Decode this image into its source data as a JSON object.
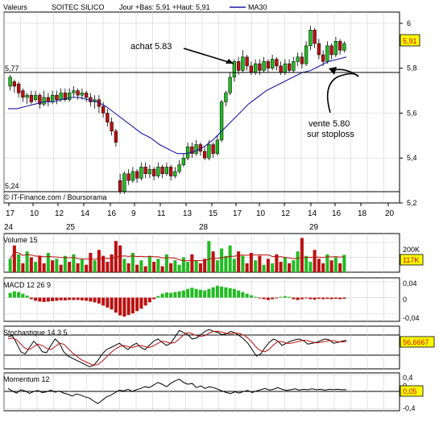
{
  "header": {
    "valeurs": "Valeurs",
    "symbol": "SOITEC SILICO",
    "ohlc": "Jour +Bas: 5,91 +Haut: 5,91",
    "ma_label": "MA30"
  },
  "main": {
    "credit": "IT-Finance.com / Boursorama",
    "last_price": "5,91",
    "ref_high": "5,77",
    "ref_low": "5,24",
    "y_ticks": [
      "6",
      "5,8",
      "5,6",
      "5,4",
      "5,2"
    ],
    "x_ticks": [
      "17",
      "10",
      "12",
      "14",
      "16",
      "9",
      "11",
      "13",
      "15",
      "17",
      "10",
      "12",
      "14",
      "16",
      "18",
      "20"
    ],
    "x_days": [
      "24",
      "25",
      "28",
      "29"
    ],
    "annot_buy": "achat 5.83",
    "annot_sell1": "vente 5.80",
    "annot_sell2": "sur stoploss"
  },
  "volume": {
    "title": "Volume 15",
    "tick": "200K",
    "value": "117K"
  },
  "macd": {
    "title": "MACD 12 26 9",
    "ticks": [
      "0,04",
      "0",
      "-0,04"
    ]
  },
  "stoch": {
    "title": "Stochastique 14 3 5",
    "value": "56,6667"
  },
  "momentum": {
    "title": "Momentum 12",
    "ticks": [
      "0,4",
      "0",
      "-0,4"
    ],
    "value": "0,05"
  },
  "colors": {
    "up": "#22bb22",
    "down": "#bb1111",
    "ma": "#1a1aa0",
    "badge": "#ffff00",
    "badge_text": "#cc0000"
  },
  "chart_data": [
    {
      "type": "candlestick",
      "title": "SOITEC SILICO",
      "overlay": "MA30",
      "ylim": [
        5.2,
        6.05
      ],
      "x_day_labels": [
        "24",
        "25",
        "28",
        "29"
      ],
      "reference_lines": [
        5.77,
        5.24
      ],
      "candles": [
        [
          5.72,
          5.76,
          5.7,
          5.77
        ],
        [
          5.74,
          5.72,
          5.69,
          5.75
        ],
        [
          5.73,
          5.69,
          5.67,
          5.74
        ],
        [
          5.7,
          5.67,
          5.65,
          5.71
        ],
        [
          5.67,
          5.68,
          5.64,
          5.69
        ],
        [
          5.68,
          5.65,
          5.64,
          5.7
        ],
        [
          5.66,
          5.68,
          5.65,
          5.7
        ],
        [
          5.68,
          5.64,
          5.62,
          5.69
        ],
        [
          5.64,
          5.67,
          5.63,
          5.7
        ],
        [
          5.67,
          5.65,
          5.63,
          5.69
        ],
        [
          5.65,
          5.68,
          5.64,
          5.7
        ],
        [
          5.68,
          5.66,
          5.64,
          5.7
        ],
        [
          5.66,
          5.69,
          5.65,
          5.71
        ],
        [
          5.69,
          5.66,
          5.65,
          5.71
        ],
        [
          5.66,
          5.69,
          5.65,
          5.71
        ],
        [
          5.69,
          5.7,
          5.67,
          5.72
        ],
        [
          5.7,
          5.68,
          5.66,
          5.71
        ],
        [
          5.68,
          5.69,
          5.66,
          5.71
        ],
        [
          5.69,
          5.67,
          5.65,
          5.7
        ],
        [
          5.67,
          5.65,
          5.63,
          5.69
        ],
        [
          5.65,
          5.66,
          5.62,
          5.68
        ],
        [
          5.66,
          5.63,
          5.6,
          5.68
        ],
        [
          5.63,
          5.6,
          5.58,
          5.65
        ],
        [
          5.6,
          5.56,
          5.54,
          5.62
        ],
        [
          5.56,
          5.52,
          5.5,
          5.58
        ],
        [
          5.52,
          5.47,
          5.45,
          5.53
        ],
        [
          5.3,
          5.25,
          5.24,
          5.33
        ],
        [
          5.25,
          5.33,
          5.24,
          5.34
        ],
        [
          5.33,
          5.3,
          5.28,
          5.35
        ],
        [
          5.3,
          5.34,
          5.29,
          5.36
        ],
        [
          5.34,
          5.31,
          5.29,
          5.35
        ],
        [
          5.31,
          5.36,
          5.3,
          5.38
        ],
        [
          5.36,
          5.33,
          5.31,
          5.38
        ],
        [
          5.33,
          5.35,
          5.31,
          5.37
        ],
        [
          5.35,
          5.32,
          5.3,
          5.36
        ],
        [
          5.32,
          5.36,
          5.31,
          5.38
        ],
        [
          5.36,
          5.33,
          5.31,
          5.37
        ],
        [
          5.33,
          5.36,
          5.32,
          5.38
        ],
        [
          5.36,
          5.32,
          5.3,
          5.37
        ],
        [
          5.32,
          5.34,
          5.31,
          5.36
        ],
        [
          5.34,
          5.37,
          5.33,
          5.39
        ],
        [
          5.37,
          5.4,
          5.36,
          5.42
        ],
        [
          5.4,
          5.45,
          5.39,
          5.47
        ],
        [
          5.45,
          5.42,
          5.4,
          5.47
        ],
        [
          5.42,
          5.46,
          5.41,
          5.48
        ],
        [
          5.46,
          5.43,
          5.41,
          5.47
        ],
        [
          5.43,
          5.4,
          5.39,
          5.45
        ],
        [
          5.4,
          5.46,
          5.39,
          5.48
        ],
        [
          5.46,
          5.42,
          5.4,
          5.47
        ],
        [
          5.42,
          5.48,
          5.41,
          5.5
        ],
        [
          5.48,
          5.65,
          5.47,
          5.66
        ],
        [
          5.65,
          5.69,
          5.63,
          5.7
        ],
        [
          5.69,
          5.76,
          5.68,
          5.78
        ],
        [
          5.76,
          5.83,
          5.74,
          5.84
        ],
        [
          5.83,
          5.79,
          5.77,
          5.85
        ],
        [
          5.79,
          5.85,
          5.78,
          5.88
        ],
        [
          5.85,
          5.81,
          5.79,
          5.86
        ],
        [
          5.81,
          5.78,
          5.77,
          5.83
        ],
        [
          5.78,
          5.82,
          5.77,
          5.84
        ],
        [
          5.82,
          5.79,
          5.77,
          5.84
        ],
        [
          5.79,
          5.83,
          5.78,
          5.85
        ],
        [
          5.83,
          5.8,
          5.78,
          5.84
        ],
        [
          5.8,
          5.84,
          5.79,
          5.86
        ],
        [
          5.84,
          5.81,
          5.79,
          5.85
        ],
        [
          5.81,
          5.78,
          5.77,
          5.83
        ],
        [
          5.78,
          5.82,
          5.77,
          5.84
        ],
        [
          5.82,
          5.79,
          5.78,
          5.84
        ],
        [
          5.79,
          5.83,
          5.78,
          5.85
        ],
        [
          5.83,
          5.85,
          5.81,
          5.87
        ],
        [
          5.85,
          5.82,
          5.8,
          5.87
        ],
        [
          5.82,
          5.9,
          5.81,
          5.92
        ],
        [
          5.9,
          5.97,
          5.88,
          5.99
        ],
        [
          5.97,
          5.91,
          5.89,
          5.98
        ],
        [
          5.91,
          5.86,
          5.84,
          5.93
        ],
        [
          5.86,
          5.83,
          5.81,
          5.88
        ],
        [
          5.83,
          5.9,
          5.82,
          5.92
        ],
        [
          5.9,
          5.86,
          5.84,
          5.91
        ],
        [
          5.86,
          5.92,
          5.85,
          5.94
        ],
        [
          5.92,
          5.88,
          5.86,
          5.93
        ],
        [
          5.88,
          5.91,
          5.87,
          5.92
        ]
      ],
      "ma30": [
        5.62,
        5.62,
        5.63,
        5.64,
        5.65,
        5.65,
        5.66,
        5.67,
        5.67,
        5.66,
        5.65,
        5.63,
        5.6,
        5.57,
        5.54,
        5.51,
        5.49,
        5.46,
        5.44,
        5.42,
        5.42,
        5.43,
        5.45,
        5.48,
        5.52,
        5.56,
        5.6,
        5.64,
        5.67,
        5.7,
        5.72,
        5.74,
        5.76,
        5.78,
        5.79,
        5.81,
        5.83,
        5.84,
        5.85
      ],
      "annotations": [
        "achat 5.83",
        "vente 5.80",
        "sur stoploss"
      ]
    },
    {
      "type": "bar",
      "title": "Volume 15",
      "ylim": [
        0,
        260
      ],
      "values": [
        90,
        180,
        120,
        60,
        140,
        100,
        70,
        110,
        60,
        130,
        80,
        90,
        50,
        110,
        70,
        120,
        60,
        90,
        50,
        130,
        80,
        150,
        110,
        70,
        120,
        210,
        180,
        90,
        60,
        130,
        50,
        80,
        40,
        110,
        70,
        90,
        40,
        120,
        60,
        80,
        50,
        100,
        70,
        120,
        80,
        60,
        90,
        210,
        140,
        80,
        160,
        110,
        180,
        90,
        140,
        110,
        60,
        130,
        80,
        110,
        50,
        90,
        60,
        120,
        70,
        100,
        60,
        80,
        140,
        230,
        110,
        70,
        150,
        90,
        60,
        120,
        80,
        100,
        60,
        117
      ],
      "colors_up": [
        1,
        0,
        1,
        0,
        1,
        0,
        1,
        0,
        0,
        1,
        0,
        1,
        0,
        1,
        0,
        1,
        0,
        1,
        0,
        0,
        1,
        0,
        0,
        0,
        0,
        0,
        0,
        1,
        0,
        1,
        0,
        1,
        0,
        1,
        0,
        1,
        0,
        1,
        0,
        1,
        1,
        1,
        1,
        0,
        1,
        0,
        0,
        1,
        0,
        1,
        1,
        1,
        1,
        1,
        0,
        1,
        0,
        0,
        1,
        0,
        1,
        0,
        1,
        0,
        0,
        1,
        0,
        1,
        1,
        0,
        1,
        1,
        0,
        0,
        0,
        1,
        0,
        1,
        0,
        1
      ]
    },
    {
      "type": "bar",
      "title": "MACD 12 26 9",
      "ylim": [
        -0.06,
        0.05
      ],
      "values": [
        0.012,
        0.016,
        0.014,
        0.01,
        0.005,
        -0.004,
        -0.008,
        -0.01,
        -0.011,
        -0.01,
        -0.009,
        -0.008,
        -0.007,
        -0.007,
        -0.006,
        -0.006,
        -0.006,
        -0.007,
        -0.008,
        -0.01,
        -0.012,
        -0.015,
        -0.02,
        -0.025,
        -0.03,
        -0.038,
        -0.045,
        -0.048,
        -0.044,
        -0.04,
        -0.034,
        -0.028,
        -0.02,
        -0.012,
        -0.004,
        0.004,
        0.01,
        0.013,
        0.012,
        0.014,
        0.016,
        0.018,
        0.022,
        0.025,
        0.022,
        0.02,
        0.018,
        0.022,
        0.026,
        0.03,
        0.028,
        0.026,
        0.024,
        0.022,
        0.018,
        0.014,
        0.01,
        0.006,
        0.002,
        -0.002,
        -0.004,
        -0.006,
        -0.004,
        -0.002,
        0.002,
        0.004,
        0.002,
        -0.004,
        -0.006,
        -0.004,
        -0.002,
        -0.004,
        -0.005,
        -0.003,
        -0.004,
        -0.003,
        -0.004,
        -0.003,
        -0.004,
        -0.003
      ]
    },
    {
      "type": "line",
      "title": "Stochastique 14 3 5",
      "ylim": [
        0,
        100
      ],
      "series": [
        {
          "values": [
            75,
            78,
            60,
            40,
            35,
            50,
            65,
            55,
            40,
            38,
            55,
            70,
            60,
            40,
            30,
            25,
            20,
            15,
            10,
            5,
            8,
            20,
            35,
            45,
            50,
            55,
            60,
            52,
            45,
            55,
            60,
            50,
            45,
            55,
            65,
            70,
            62,
            55,
            60,
            75,
            90,
            85,
            80,
            70,
            72,
            80,
            88,
            92,
            88,
            85,
            80,
            82,
            88,
            84,
            78,
            70,
            60,
            45,
            30,
            35,
            50,
            62,
            70,
            65,
            55,
            60,
            65,
            68,
            70,
            66,
            58,
            60,
            62,
            66,
            70,
            68,
            60,
            62,
            65,
            67
          ]
        },
        {
          "values": [
            70,
            72,
            68,
            58,
            48,
            45,
            52,
            58,
            55,
            48,
            45,
            52,
            60,
            58,
            48,
            38,
            30,
            22,
            17,
            12,
            9,
            10,
            18,
            28,
            38,
            46,
            52,
            55,
            52,
            50,
            53,
            55,
            52,
            50,
            54,
            60,
            65,
            63,
            60,
            62,
            70,
            80,
            85,
            82,
            78,
            76,
            78,
            84,
            88,
            88,
            86,
            83,
            82,
            84,
            83,
            79,
            72,
            62,
            50,
            42,
            40,
            46,
            56,
            64,
            64,
            60,
            60,
            62,
            65,
            67,
            66,
            63,
            61,
            62,
            64,
            66,
            66,
            64,
            63,
            64
          ]
        }
      ]
    },
    {
      "type": "line",
      "title": "Momentum 12",
      "ylim": [
        -0.45,
        0.45
      ],
      "series": [
        {
          "values": [
            0.08,
            0.02,
            -0.03,
            0.05,
            0.02,
            -0.04,
            0.01,
            0.03,
            -0.02,
            0.0,
            0.04,
            -0.01,
            0.02,
            -0.03,
            -0.06,
            -0.1,
            -0.05,
            -0.08,
            -0.12,
            -0.15,
            -0.22,
            -0.28,
            -0.2,
            -0.12,
            -0.08,
            -0.02,
            0.04,
            0.02,
            0.06,
            0.01,
            0.05,
            0.08,
            0.12,
            0.1,
            0.16,
            0.22,
            0.18,
            0.12,
            0.2,
            0.26,
            0.3,
            0.22,
            0.18,
            0.2,
            0.1,
            0.14,
            0.08,
            0.12,
            0.1,
            0.06,
            0.02,
            -0.02,
            -0.04,
            0.0,
            -0.03,
            0.01,
            0.03,
            -0.02,
            0.02,
            0.05,
            0.08,
            0.04,
            0.06,
            0.1,
            0.06,
            0.03,
            0.05,
            0.07,
            0.04,
            0.06,
            0.05,
            0.07,
            0.05,
            0.06,
            0.04,
            0.06,
            0.05,
            0.06,
            0.05,
            0.05
          ]
        }
      ]
    }
  ]
}
